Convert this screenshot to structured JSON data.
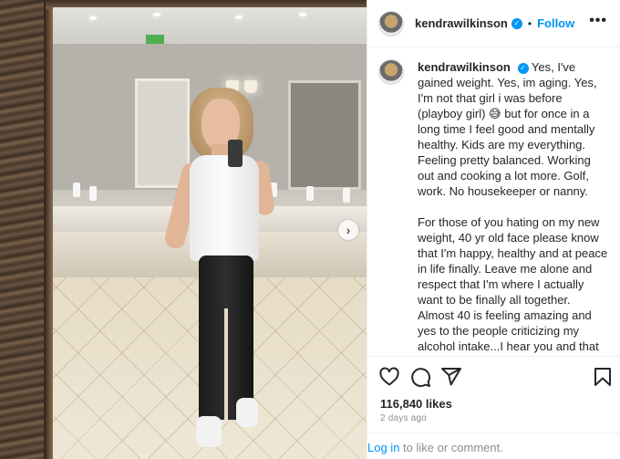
{
  "post": {
    "username": "kendrawilkinson",
    "follow_label": "Follow",
    "dot": "•",
    "more_label": "•••",
    "next_arrow": "›"
  },
  "caption": {
    "username": "kendrawilkinson",
    "paragraph1": "Yes, I've gained weight. Yes, im aging. Yes, I'm not that girl i was before (playboy girl) 😅 but for once in a long time I feel good and mentally healthy. Kids are my everything. Feeling pretty balanced. Working out and cooking a lot more. Golf, work. No housekeeper or nanny.",
    "paragraph2": "For those of you hating on my new weight, 40 yr old face please know that I'm happy, healthy and at peace in life finally. Leave me alone and respect that I'm where I actually want to be finally all together. Almost 40 is feeling amazing and yes to the people criticizing my alcohol intake...I hear you and that will be monitored better. Drinking too much is definitely drinking too much but you know what's coming"
  },
  "stats": {
    "likes": "116,840 likes",
    "time": "2 days ago"
  },
  "footer": {
    "login_link": "Log in",
    "login_text": " to like or comment."
  },
  "icons": [
    "heart-icon",
    "comment-icon",
    "share-icon",
    "bookmark-icon",
    "verified-badge-icon",
    "more-icon",
    "chevron-right-icon"
  ],
  "colors": {
    "accent": "#0095f6",
    "text": "#262626",
    "muted": "#8e8e8e",
    "divider": "#efefef"
  }
}
